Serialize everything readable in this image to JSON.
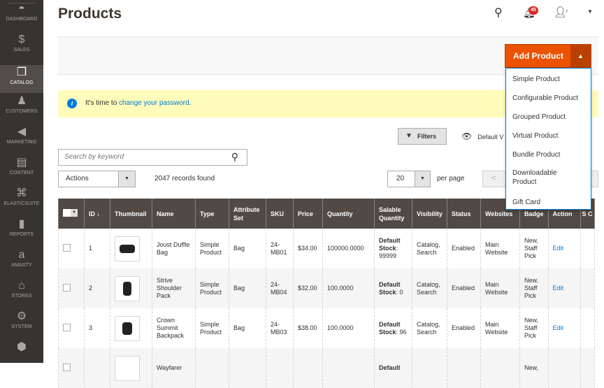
{
  "sidebar": {
    "items": [
      {
        "label": "DASHBOARD",
        "icon": "dashboard-icon",
        "glyph": "◓"
      },
      {
        "label": "SALES",
        "icon": "dollar-icon",
        "glyph": "$"
      },
      {
        "label": "CATALOG",
        "icon": "box-icon",
        "glyph": "❒"
      },
      {
        "label": "CUSTOMERS",
        "icon": "person-icon",
        "glyph": "♟"
      },
      {
        "label": "MARKETING",
        "icon": "megaphone-icon",
        "glyph": "◀"
      },
      {
        "label": "CONTENT",
        "icon": "layout-icon",
        "glyph": "▤"
      },
      {
        "label": "ELASTICSUITE",
        "icon": "rabbit-icon",
        "glyph": "⌘"
      },
      {
        "label": "REPORTS",
        "icon": "bar-chart-icon",
        "glyph": "▮"
      },
      {
        "label": "AMASTY",
        "icon": "amasty-icon",
        "glyph": "a"
      },
      {
        "label": "STORES",
        "icon": "store-icon",
        "glyph": "⌂"
      },
      {
        "label": "SYSTEM",
        "icon": "gear-icon",
        "glyph": "⚙"
      },
      {
        "label": "",
        "icon": "extensions-icon",
        "glyph": "⬢"
      }
    ]
  },
  "header": {
    "title": "Products",
    "notifications_count": "45",
    "user_name": "r"
  },
  "add_product": {
    "label": "Add Product",
    "menu": [
      "Simple Product",
      "Configurable Product",
      "Grouped Product",
      "Virtual Product",
      "Bundle Product",
      "Downloadable Product",
      "Gift Card"
    ]
  },
  "notice": {
    "prefix": "It's time to ",
    "link": "change your password",
    "suffix": "."
  },
  "toolbar": {
    "filters_label": "Filters",
    "view_label": "Default V",
    "search_placeholder": "Search by keyword",
    "actions_label": "Actions",
    "records": "2047 records found",
    "per_page_value": "20",
    "per_page_label": "per page"
  },
  "table": {
    "headers": [
      "",
      "ID ↓",
      "Thumbnail",
      "Name",
      "Type",
      "Attribute Set",
      "SKU",
      "Price",
      "Quantity",
      "Salable Quantity",
      "Visibility",
      "Status",
      "Websites",
      "Badge",
      "Action",
      "S C"
    ],
    "rows": [
      {
        "id": "1",
        "name": "Joust Duffle Bag",
        "type": "Simple Product",
        "attr": "Bag",
        "sku": "24-MB01",
        "price": "$34.00",
        "qty": "100000.0000",
        "salable_label": "Default Stock",
        "salable_value": ": 99999",
        "visibility": "Catalog, Search",
        "status": "Enabled",
        "websites": "Main Website",
        "badge": "New, Staff Pick",
        "action": "Edit"
      },
      {
        "id": "2",
        "name": "Strive Shoulder Pack",
        "type": "Simple Product",
        "attr": "Bag",
        "sku": "24-MB04",
        "price": "$32.00",
        "qty": "100.0000",
        "salable_label": "Default Stock",
        "salable_value": ": 0",
        "visibility": "Catalog, Search",
        "status": "Enabled",
        "websites": "Main Website",
        "badge": "New, Staff Pick",
        "action": "Edit"
      },
      {
        "id": "3",
        "name": "Crown Summit Backpack",
        "type": "Simple Product",
        "attr": "Bag",
        "sku": "24-MB03",
        "price": "$38.00",
        "qty": "100.0000",
        "salable_label": "Default Stock",
        "salable_value": ": 96",
        "visibility": "Catalog, Search",
        "status": "Enabled",
        "websites": "Main Website",
        "badge": "New, Staff Pick",
        "action": "Edit"
      },
      {
        "id": "",
        "name": "Wayfarer",
        "type": "",
        "attr": "",
        "sku": "",
        "price": "",
        "qty": "",
        "salable_label": "Default",
        "salable_value": "",
        "visibility": "",
        "status": "",
        "websites": "",
        "badge": "New,",
        "action": ""
      }
    ]
  }
}
